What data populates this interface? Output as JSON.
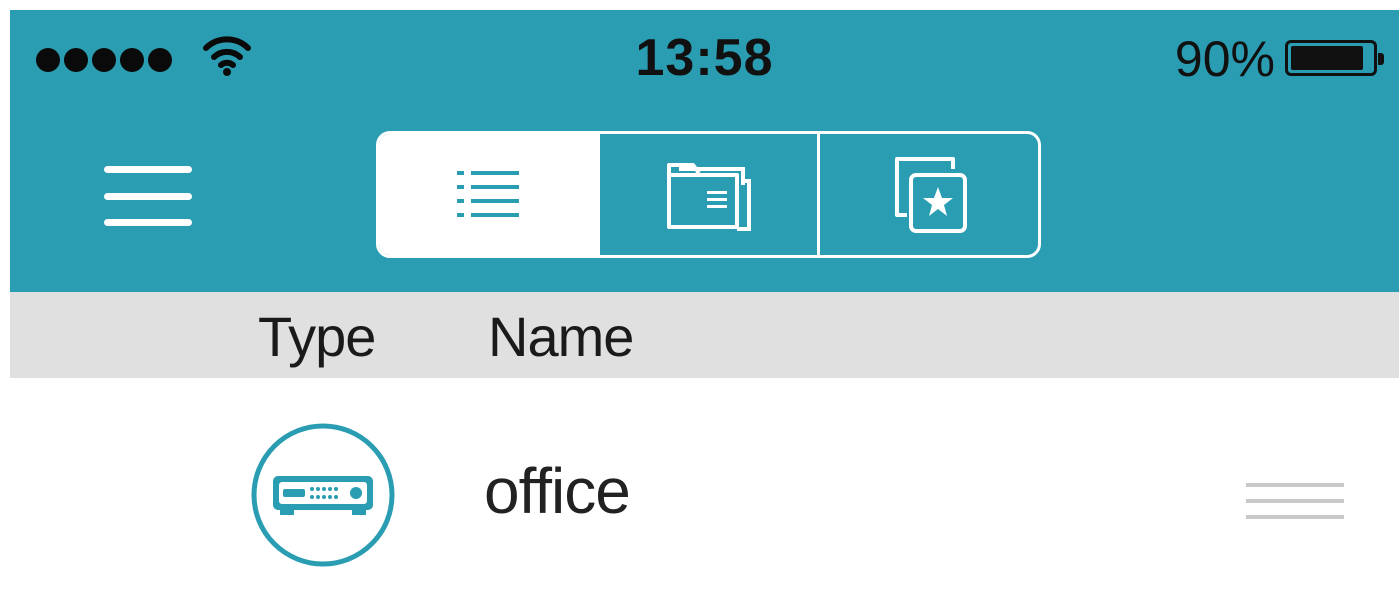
{
  "status_bar": {
    "time": "13:58",
    "battery_percent": "90%",
    "battery_level": 0.9,
    "signal_bars": 5
  },
  "nav": {
    "menu_icon": "hamburger-menu-icon",
    "segments": [
      {
        "icon": "list-icon",
        "selected": true
      },
      {
        "icon": "folder-icon",
        "selected": false
      },
      {
        "icon": "favorites-icon",
        "selected": false
      }
    ]
  },
  "columns": {
    "type": "Type",
    "name": "Name"
  },
  "items": [
    {
      "name": "office",
      "icon": "network-device-icon"
    }
  ],
  "colors": {
    "accent": "#2a9db3",
    "header_bg": "#e0e0e0",
    "text": "#222222"
  }
}
